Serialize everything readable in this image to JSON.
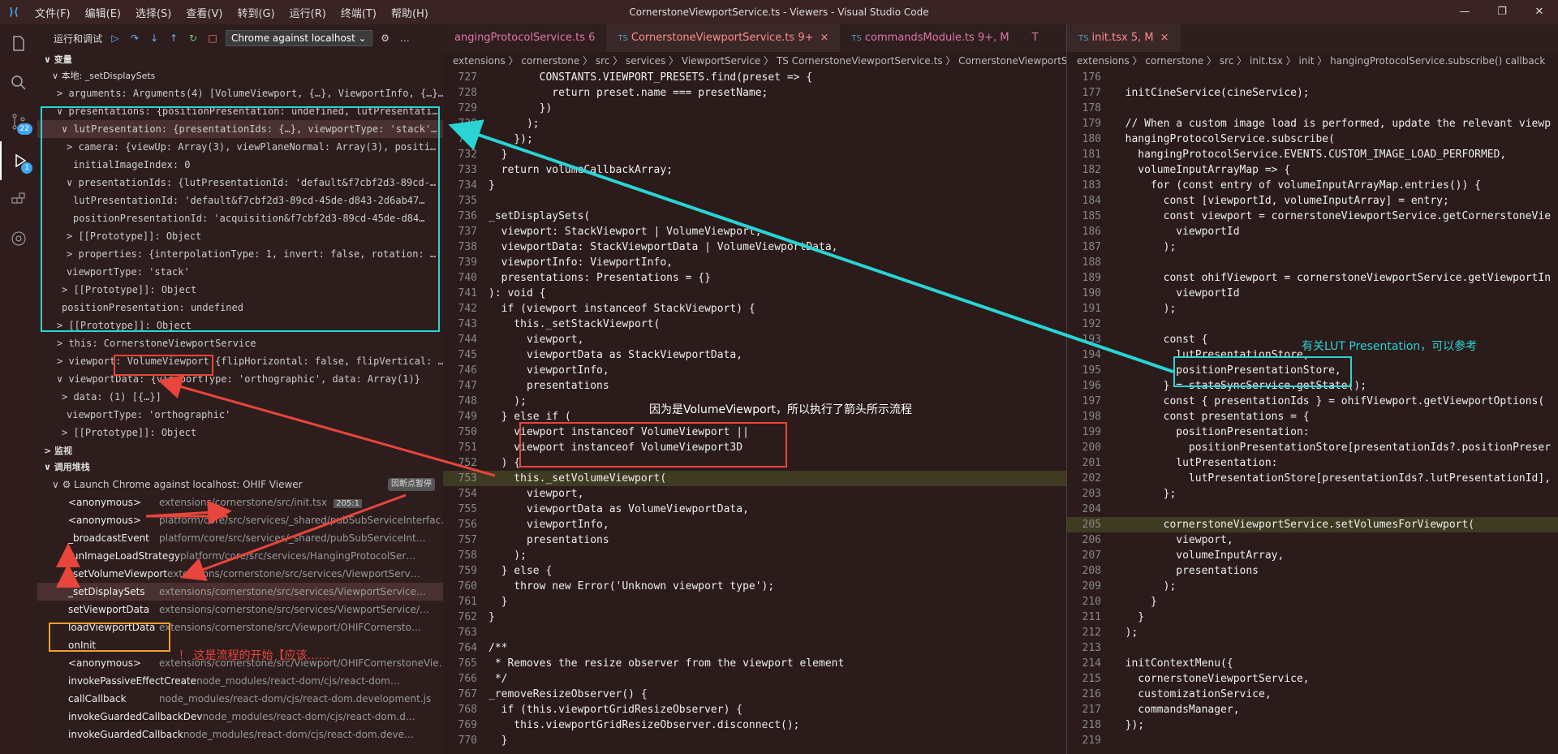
{
  "window": {
    "title": "CornerstoneViewportService.ts - Viewers - Visual Studio Code",
    "menu": [
      "文件(F)",
      "编辑(E)",
      "选择(S)",
      "查看(V)",
      "转到(G)",
      "运行(R)",
      "终端(T)",
      "帮助(H)"
    ],
    "controls": [
      "—",
      "❐",
      "✕"
    ]
  },
  "activity": {
    "scm_badge": "22",
    "debug_badge": "1"
  },
  "debug": {
    "title": "运行和调试",
    "config": "Chrome against localhost"
  },
  "variables": {
    "header": "变量",
    "scope": "本地: _setDisplaySets",
    "rows": [
      {
        "t": "> arguments: Arguments(4) [VolumeViewport, {…}, ViewportInfo, {…}…"
      },
      {
        "t": "∨ presentations: {positionPresentation: undefined, lutPresentati…"
      },
      {
        "t": "∨ lutPresentation: {presentationIds: {…}, viewportType: 'stack'…"
      },
      {
        "t": "> camera: {viewUp: Array(3), viewPlaneNormal: Array(3), positi…"
      },
      {
        "t": "initialImageIndex: 0"
      },
      {
        "t": "∨ presentationIds: {lutPresentationId: 'default&f7cbf2d3-89cd-…"
      },
      {
        "t": "lutPresentationId: 'default&f7cbf2d3-89cd-45de-d843-2d6ab47…"
      },
      {
        "t": "positionPresentationId: 'acquisition&f7cbf2d3-89cd-45de-d84…"
      },
      {
        "t": "> [[Prototype]]: Object"
      },
      {
        "t": "> properties: {interpolationType: 1, invert: false, rotation: …"
      },
      {
        "t": "viewportType: 'stack'"
      },
      {
        "t": "> [[Prototype]]: Object"
      },
      {
        "t": "positionPresentation: undefined"
      },
      {
        "t": "> [[Prototype]]: Object"
      },
      {
        "t": "> this: CornerstoneViewportService"
      },
      {
        "t": "> viewport: VolumeViewport {flipHorizontal: false, flipVertical: …"
      },
      {
        "t": "∨ viewportData: {viewportType: 'orthographic', data: Array(1)}"
      },
      {
        "t": "> data: (1) [{…}]"
      },
      {
        "t": "viewportType: 'orthographic'"
      },
      {
        "t": "> [[Prototype]]: Object"
      }
    ]
  },
  "watch": {
    "header": "监视"
  },
  "callstack": {
    "header": "调用堆栈",
    "thread": "Launch Chrome against localhost: OHIF Viewer",
    "paused": "因断点暂停",
    "frames": [
      {
        "fn": "<anonymous>",
        "path": "extensions/cornerstone/src/init.tsx",
        "loc": "205:1"
      },
      {
        "fn": "<anonymous>",
        "path": "platform/core/src/services/_shared/pubSubServiceInterfac…",
        "loc": ""
      },
      {
        "fn": "_broadcastEvent",
        "path": "platform/core/src/services/_shared/pubSubServiceInt…",
        "loc": ""
      },
      {
        "fn": "runImageLoadStrategy",
        "path": "platform/core/src/services/HangingProtocolSer…",
        "loc": ""
      },
      {
        "fn": "_setVolumeViewport",
        "path": "extensions/cornerstone/src/services/ViewportServ…",
        "loc": ""
      },
      {
        "fn": "_setDisplaySets",
        "path": "extensions/cornerstone/src/services/ViewportService…",
        "loc": ""
      },
      {
        "fn": "setViewportData",
        "path": "extensions/cornerstone/src/services/ViewportService/…",
        "loc": ""
      },
      {
        "fn": "loadViewportData",
        "path": "extensions/cornerstone/src/Viewport/OHIFCornersto…",
        "loc": ""
      },
      {
        "fn": "onInit",
        "path": "",
        "loc": ""
      },
      {
        "fn": "<anonymous>",
        "path": "extensions/cornerstone/src/Viewport/OHIFCornerstoneVie…",
        "loc": ""
      },
      {
        "fn": "invokePassiveEffectCreate",
        "path": "node_modules/react-dom/cjs/react-dom…",
        "loc": ""
      },
      {
        "fn": "callCallback",
        "path": "node_modules/react-dom/cjs/react-dom.development.js",
        "loc": ""
      },
      {
        "fn": "invokeGuardedCallbackDev",
        "path": "node_modules/react-dom/cjs/react-dom.d…",
        "loc": ""
      },
      {
        "fn": "invokeGuardedCallback",
        "path": "node_modules/react-dom/cjs/react-dom.deve…",
        "loc": ""
      }
    ]
  },
  "editor1": {
    "tabs": [
      {
        "label": "angingProtocolService.ts 6",
        "ts": ""
      },
      {
        "label": "CornerstoneViewportService.ts 9+",
        "ts": "TS",
        "active": true
      },
      {
        "label": "commandsModule.ts 9+, M",
        "ts": "TS"
      },
      {
        "label": "T",
        "ts": ""
      }
    ],
    "crumbs": "extensions 〉 cornerstone 〉 src 〉 services 〉 ViewportService 〉 TS CornerstoneViewportService.ts 〉 CornerstoneViewportService",
    "lines": [
      {
        "n": "727",
        "t": "        CONSTANTS.VIEWPORT_PRESETS.find(preset => {"
      },
      {
        "n": "728",
        "t": "          return preset.name === presetName;"
      },
      {
        "n": "729",
        "t": "        })"
      },
      {
        "n": "730",
        "t": "      );"
      },
      {
        "n": "731",
        "t": "    });"
      },
      {
        "n": "732",
        "t": "  }"
      },
      {
        "n": "733",
        "t": "  return volumeCallbackArray;"
      },
      {
        "n": "734",
        "t": "}"
      },
      {
        "n": "735",
        "t": ""
      },
      {
        "n": "736",
        "t": "_setDisplaySets("
      },
      {
        "n": "737",
        "t": "  viewport: StackViewport | VolumeViewport,"
      },
      {
        "n": "738",
        "t": "  viewportData: StackViewportData | VolumeViewportData,"
      },
      {
        "n": "739",
        "t": "  viewportInfo: ViewportInfo,"
      },
      {
        "n": "740",
        "t": "  presentations: Presentations = {}"
      },
      {
        "n": "741",
        "t": "): void {"
      },
      {
        "n": "742",
        "t": "  if (viewport instanceof StackViewport) {"
      },
      {
        "n": "743",
        "t": "    this._setStackViewport("
      },
      {
        "n": "744",
        "t": "      viewport,"
      },
      {
        "n": "745",
        "t": "      viewportData as StackViewportData,"
      },
      {
        "n": "746",
        "t": "      viewportInfo,"
      },
      {
        "n": "747",
        "t": "      presentations"
      },
      {
        "n": "748",
        "t": "    );"
      },
      {
        "n": "749",
        "t": "  } else if ("
      },
      {
        "n": "750",
        "t": "    viewport instanceof VolumeViewport ||"
      },
      {
        "n": "751",
        "t": "    viewport instanceof VolumeViewport3D"
      },
      {
        "n": "752",
        "t": "  ) {"
      },
      {
        "n": "753",
        "t": "    this._setVolumeViewport("
      },
      {
        "n": "754",
        "t": "      viewport,"
      },
      {
        "n": "755",
        "t": "      viewportData as VolumeViewportData,"
      },
      {
        "n": "756",
        "t": "      viewportInfo,"
      },
      {
        "n": "757",
        "t": "      presentations"
      },
      {
        "n": "758",
        "t": "    );"
      },
      {
        "n": "759",
        "t": "  } else {"
      },
      {
        "n": "760",
        "t": "    throw new Error('Unknown viewport type');"
      },
      {
        "n": "761",
        "t": "  }"
      },
      {
        "n": "762",
        "t": "}"
      },
      {
        "n": "763",
        "t": ""
      },
      {
        "n": "764",
        "t": "/**"
      },
      {
        "n": "765",
        "t": " * Removes the resize observer from the viewport element"
      },
      {
        "n": "766",
        "t": " */"
      },
      {
        "n": "767",
        "t": "_removeResizeObserver() {"
      },
      {
        "n": "768",
        "t": "  if (this.viewportGridResizeObserver) {"
      },
      {
        "n": "769",
        "t": "    this.viewportGridResizeObserver.disconnect();"
      },
      {
        "n": "770",
        "t": "  }"
      }
    ]
  },
  "editor2": {
    "tabs": [
      {
        "label": "init.tsx 5, M",
        "ts": "TS",
        "active": true
      }
    ],
    "crumbs": "extensions 〉 cornerstone 〉 src 〉 init.tsx 〉 init 〉 hangingProtocolService.subscribe() callback",
    "lines": [
      {
        "n": "176",
        "t": ""
      },
      {
        "n": "177",
        "t": "  initCineService(cineService);"
      },
      {
        "n": "178",
        "t": ""
      },
      {
        "n": "179",
        "t": "  // When a custom image load is performed, update the relevant viewp"
      },
      {
        "n": "180",
        "t": "  hangingProtocolService.subscribe("
      },
      {
        "n": "181",
        "t": "    hangingProtocolService.EVENTS.CUSTOM_IMAGE_LOAD_PERFORMED,"
      },
      {
        "n": "182",
        "t": "    volumeInputArrayMap => {"
      },
      {
        "n": "183",
        "t": "      for (const entry of volumeInputArrayMap.entries()) {"
      },
      {
        "n": "184",
        "t": "        const [viewportId, volumeInputArray] = entry;"
      },
      {
        "n": "185",
        "t": "        const viewport = cornerstoneViewportService.getCornerstoneVie"
      },
      {
        "n": "186",
        "t": "          viewportId"
      },
      {
        "n": "187",
        "t": "        );"
      },
      {
        "n": "188",
        "t": ""
      },
      {
        "n": "189",
        "t": "        const ohifViewport = cornerstoneViewportService.getViewportIn"
      },
      {
        "n": "190",
        "t": "          viewportId"
      },
      {
        "n": "191",
        "t": "        );"
      },
      {
        "n": "192",
        "t": ""
      },
      {
        "n": "193",
        "t": "        const {"
      },
      {
        "n": "194",
        "t": "          lutPresentationStore,"
      },
      {
        "n": "195",
        "t": "          positionPresentationStore,"
      },
      {
        "n": "196",
        "t": "        } = stateSyncService.getState();"
      },
      {
        "n": "197",
        "t": "        const { presentationIds } = ohifViewport.getViewportOptions("
      },
      {
        "n": "198",
        "t": "        const presentations = {"
      },
      {
        "n": "199",
        "t": "          positionPresentation:"
      },
      {
        "n": "200",
        "t": "            positionPresentationStore[presentationIds?.positionPreser"
      },
      {
        "n": "201",
        "t": "          lutPresentation:"
      },
      {
        "n": "202",
        "t": "            lutPresentationStore[presentationIds?.lutPresentationId],"
      },
      {
        "n": "203",
        "t": "        };"
      },
      {
        "n": "204",
        "t": ""
      },
      {
        "n": "205",
        "t": "        cornerstoneViewportService.setVolumesForViewport("
      },
      {
        "n": "206",
        "t": "          viewport,"
      },
      {
        "n": "207",
        "t": "          volumeInputArray,"
      },
      {
        "n": "208",
        "t": "          presentations"
      },
      {
        "n": "209",
        "t": "        );"
      },
      {
        "n": "210",
        "t": "      }"
      },
      {
        "n": "211",
        "t": "    }"
      },
      {
        "n": "212",
        "t": "  );"
      },
      {
        "n": "213",
        "t": ""
      },
      {
        "n": "214",
        "t": "  initContextMenu({"
      },
      {
        "n": "215",
        "t": "    cornerstoneViewportService,"
      },
      {
        "n": "216",
        "t": "    customizationService,"
      },
      {
        "n": "217",
        "t": "    commandsManager,"
      },
      {
        "n": "218",
        "t": "  });"
      },
      {
        "n": "219",
        "t": ""
      }
    ]
  },
  "annotations": {
    "lut_note": "有关LUT Presentation，可以参考",
    "volume_note": "因为是VolumeViewport，所以执行了箭头所示流程",
    "start_note": "！ 这是流程的开始【应该……"
  },
  "colors": {
    "cyan": "#2ad4d4",
    "red": "#e8453c",
    "orange": "#f0a030"
  }
}
